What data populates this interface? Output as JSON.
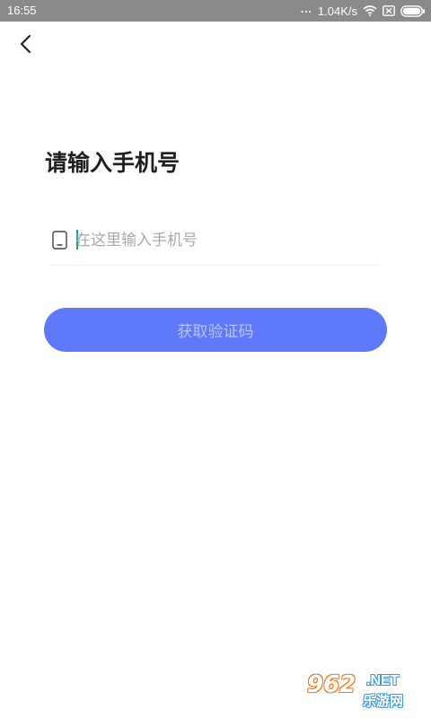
{
  "status_bar": {
    "time": "16:55",
    "dots": "...",
    "net_speed": "1.04K/s",
    "icons": [
      "wifi-icon",
      "sim-icon",
      "battery-icon"
    ],
    "background_color": "#8a8a8a"
  },
  "header": {
    "back_icon": "chevron-left-icon"
  },
  "main": {
    "title": "请输入手机号",
    "phone_input": {
      "value": "",
      "placeholder": "在这里输入手机号",
      "icon": "phone-icon"
    },
    "get_code_button": {
      "label": "获取验证码",
      "color": "#5f79fb"
    }
  },
  "watermark": {
    "number": "962",
    "net": ".NET",
    "text": "乐游网"
  }
}
